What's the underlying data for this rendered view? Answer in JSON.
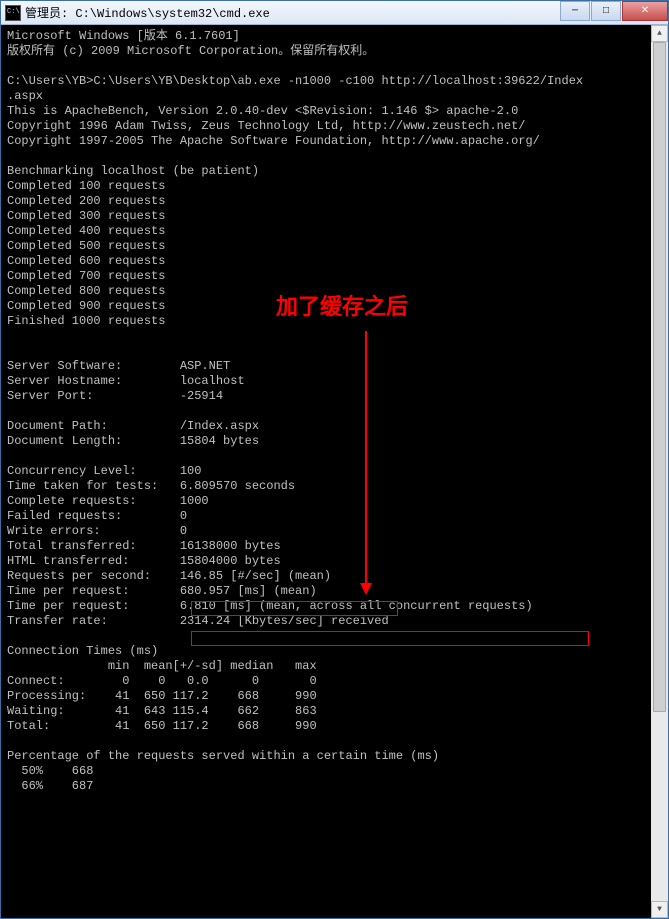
{
  "window": {
    "title": "管理员: C:\\Windows\\system32\\cmd.exe"
  },
  "annotation": {
    "label": "加了缓存之后"
  },
  "lines": {
    "l0": "Microsoft Windows [版本 6.1.7601]",
    "l1": "版权所有 (c) 2009 Microsoft Corporation。保留所有权利。",
    "l2": "",
    "l3": "C:\\Users\\YB>C:\\Users\\YB\\Desktop\\ab.exe -n1000 -c100 http://localhost:39622/Index",
    "l4": ".aspx",
    "l5": "This is ApacheBench, Version 2.0.40-dev <$Revision: 1.146 $> apache-2.0",
    "l6": "Copyright 1996 Adam Twiss, Zeus Technology Ltd, http://www.zeustech.net/",
    "l7": "Copyright 1997-2005 The Apache Software Foundation, http://www.apache.org/",
    "l8": "",
    "l9": "Benchmarking localhost (be patient)",
    "l10": "Completed 100 requests",
    "l11": "Completed 200 requests",
    "l12": "Completed 300 requests",
    "l13": "Completed 400 requests",
    "l14": "Completed 500 requests",
    "l15": "Completed 600 requests",
    "l16": "Completed 700 requests",
    "l17": "Completed 800 requests",
    "l18": "Completed 900 requests",
    "l19": "Finished 1000 requests",
    "l20": "",
    "l21": "",
    "l22": "Server Software:        ASP.NET",
    "l23": "Server Hostname:        localhost",
    "l24": "Server Port:            -25914",
    "l25": "",
    "l26": "Document Path:          /Index.aspx",
    "l27": "Document Length:        15804 bytes",
    "l28": "",
    "l29": "Concurrency Level:      100",
    "l30": "Time taken for tests:   6.809570 seconds",
    "l31": "Complete requests:      1000",
    "l32": "Failed requests:        0",
    "l33": "Write errors:           0",
    "l34": "Total transferred:      16138000 bytes",
    "l35": "HTML transferred:       15804000 bytes",
    "l36": "Requests per second:    146.85 [#/sec] (mean)",
    "l37": "Time per request:       680.957 [ms] (mean)",
    "l38": "Time per request:       6.810 [ms] (mean, across all concurrent requests)",
    "l39": "Transfer rate:          2314.24 [Kbytes/sec] received",
    "l40": "",
    "l41": "Connection Times (ms)",
    "l42": "              min  mean[+/-sd] median   max",
    "l43": "Connect:        0    0   0.0      0       0",
    "l44": "Processing:    41  650 117.2    668     990",
    "l45": "Waiting:       41  643 115.4    662     863",
    "l46": "Total:         41  650 117.2    668     990",
    "l47": "",
    "l48": "Percentage of the requests served within a certain time (ms)",
    "l49": "  50%    668",
    "l50": "  66%    687"
  }
}
